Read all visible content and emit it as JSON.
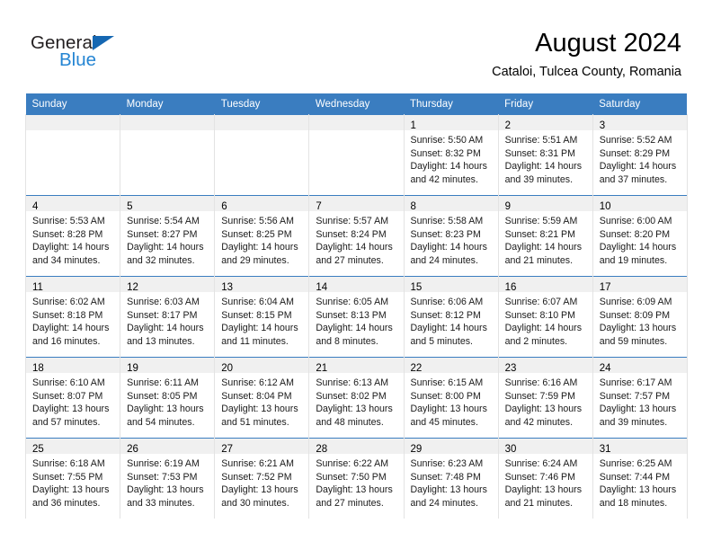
{
  "brand": {
    "name_dark": "General",
    "name_light": "Blue",
    "triangle_color": "#1567b2",
    "blue_color": "#2585d3"
  },
  "header": {
    "title": "August 2024",
    "subtitle": "Cataloi, Tulcea County, Romania"
  },
  "theme": {
    "header_row_bg": "#3a7dc0",
    "header_row_text": "#ffffff",
    "daynum_band_bg": "#f0f0f0",
    "cell_border": "#e3e3e3",
    "week_divider": "#3a7dc0"
  },
  "weekday_headers": [
    "Sunday",
    "Monday",
    "Tuesday",
    "Wednesday",
    "Thursday",
    "Friday",
    "Saturday"
  ],
  "weeks": [
    [
      {
        "day": "",
        "empty": true,
        "sunrise": "",
        "sunset": "",
        "daylight_1": "",
        "daylight_2": ""
      },
      {
        "day": "",
        "empty": true,
        "sunrise": "",
        "sunset": "",
        "daylight_1": "",
        "daylight_2": ""
      },
      {
        "day": "",
        "empty": true,
        "sunrise": "",
        "sunset": "",
        "daylight_1": "",
        "daylight_2": ""
      },
      {
        "day": "",
        "empty": true,
        "sunrise": "",
        "sunset": "",
        "daylight_1": "",
        "daylight_2": ""
      },
      {
        "day": "1",
        "empty": false,
        "sunrise": "Sunrise: 5:50 AM",
        "sunset": "Sunset: 8:32 PM",
        "daylight_1": "Daylight: 14 hours",
        "daylight_2": "and 42 minutes."
      },
      {
        "day": "2",
        "empty": false,
        "sunrise": "Sunrise: 5:51 AM",
        "sunset": "Sunset: 8:31 PM",
        "daylight_1": "Daylight: 14 hours",
        "daylight_2": "and 39 minutes."
      },
      {
        "day": "3",
        "empty": false,
        "sunrise": "Sunrise: 5:52 AM",
        "sunset": "Sunset: 8:29 PM",
        "daylight_1": "Daylight: 14 hours",
        "daylight_2": "and 37 minutes."
      }
    ],
    [
      {
        "day": "4",
        "empty": false,
        "sunrise": "Sunrise: 5:53 AM",
        "sunset": "Sunset: 8:28 PM",
        "daylight_1": "Daylight: 14 hours",
        "daylight_2": "and 34 minutes."
      },
      {
        "day": "5",
        "empty": false,
        "sunrise": "Sunrise: 5:54 AM",
        "sunset": "Sunset: 8:27 PM",
        "daylight_1": "Daylight: 14 hours",
        "daylight_2": "and 32 minutes."
      },
      {
        "day": "6",
        "empty": false,
        "sunrise": "Sunrise: 5:56 AM",
        "sunset": "Sunset: 8:25 PM",
        "daylight_1": "Daylight: 14 hours",
        "daylight_2": "and 29 minutes."
      },
      {
        "day": "7",
        "empty": false,
        "sunrise": "Sunrise: 5:57 AM",
        "sunset": "Sunset: 8:24 PM",
        "daylight_1": "Daylight: 14 hours",
        "daylight_2": "and 27 minutes."
      },
      {
        "day": "8",
        "empty": false,
        "sunrise": "Sunrise: 5:58 AM",
        "sunset": "Sunset: 8:23 PM",
        "daylight_1": "Daylight: 14 hours",
        "daylight_2": "and 24 minutes."
      },
      {
        "day": "9",
        "empty": false,
        "sunrise": "Sunrise: 5:59 AM",
        "sunset": "Sunset: 8:21 PM",
        "daylight_1": "Daylight: 14 hours",
        "daylight_2": "and 21 minutes."
      },
      {
        "day": "10",
        "empty": false,
        "sunrise": "Sunrise: 6:00 AM",
        "sunset": "Sunset: 8:20 PM",
        "daylight_1": "Daylight: 14 hours",
        "daylight_2": "and 19 minutes."
      }
    ],
    [
      {
        "day": "11",
        "empty": false,
        "sunrise": "Sunrise: 6:02 AM",
        "sunset": "Sunset: 8:18 PM",
        "daylight_1": "Daylight: 14 hours",
        "daylight_2": "and 16 minutes."
      },
      {
        "day": "12",
        "empty": false,
        "sunrise": "Sunrise: 6:03 AM",
        "sunset": "Sunset: 8:17 PM",
        "daylight_1": "Daylight: 14 hours",
        "daylight_2": "and 13 minutes."
      },
      {
        "day": "13",
        "empty": false,
        "sunrise": "Sunrise: 6:04 AM",
        "sunset": "Sunset: 8:15 PM",
        "daylight_1": "Daylight: 14 hours",
        "daylight_2": "and 11 minutes."
      },
      {
        "day": "14",
        "empty": false,
        "sunrise": "Sunrise: 6:05 AM",
        "sunset": "Sunset: 8:13 PM",
        "daylight_1": "Daylight: 14 hours",
        "daylight_2": "and 8 minutes."
      },
      {
        "day": "15",
        "empty": false,
        "sunrise": "Sunrise: 6:06 AM",
        "sunset": "Sunset: 8:12 PM",
        "daylight_1": "Daylight: 14 hours",
        "daylight_2": "and 5 minutes."
      },
      {
        "day": "16",
        "empty": false,
        "sunrise": "Sunrise: 6:07 AM",
        "sunset": "Sunset: 8:10 PM",
        "daylight_1": "Daylight: 14 hours",
        "daylight_2": "and 2 minutes."
      },
      {
        "day": "17",
        "empty": false,
        "sunrise": "Sunrise: 6:09 AM",
        "sunset": "Sunset: 8:09 PM",
        "daylight_1": "Daylight: 13 hours",
        "daylight_2": "and 59 minutes."
      }
    ],
    [
      {
        "day": "18",
        "empty": false,
        "sunrise": "Sunrise: 6:10 AM",
        "sunset": "Sunset: 8:07 PM",
        "daylight_1": "Daylight: 13 hours",
        "daylight_2": "and 57 minutes."
      },
      {
        "day": "19",
        "empty": false,
        "sunrise": "Sunrise: 6:11 AM",
        "sunset": "Sunset: 8:05 PM",
        "daylight_1": "Daylight: 13 hours",
        "daylight_2": "and 54 minutes."
      },
      {
        "day": "20",
        "empty": false,
        "sunrise": "Sunrise: 6:12 AM",
        "sunset": "Sunset: 8:04 PM",
        "daylight_1": "Daylight: 13 hours",
        "daylight_2": "and 51 minutes."
      },
      {
        "day": "21",
        "empty": false,
        "sunrise": "Sunrise: 6:13 AM",
        "sunset": "Sunset: 8:02 PM",
        "daylight_1": "Daylight: 13 hours",
        "daylight_2": "and 48 minutes."
      },
      {
        "day": "22",
        "empty": false,
        "sunrise": "Sunrise: 6:15 AM",
        "sunset": "Sunset: 8:00 PM",
        "daylight_1": "Daylight: 13 hours",
        "daylight_2": "and 45 minutes."
      },
      {
        "day": "23",
        "empty": false,
        "sunrise": "Sunrise: 6:16 AM",
        "sunset": "Sunset: 7:59 PM",
        "daylight_1": "Daylight: 13 hours",
        "daylight_2": "and 42 minutes."
      },
      {
        "day": "24",
        "empty": false,
        "sunrise": "Sunrise: 6:17 AM",
        "sunset": "Sunset: 7:57 PM",
        "daylight_1": "Daylight: 13 hours",
        "daylight_2": "and 39 minutes."
      }
    ],
    [
      {
        "day": "25",
        "empty": false,
        "sunrise": "Sunrise: 6:18 AM",
        "sunset": "Sunset: 7:55 PM",
        "daylight_1": "Daylight: 13 hours",
        "daylight_2": "and 36 minutes."
      },
      {
        "day": "26",
        "empty": false,
        "sunrise": "Sunrise: 6:19 AM",
        "sunset": "Sunset: 7:53 PM",
        "daylight_1": "Daylight: 13 hours",
        "daylight_2": "and 33 minutes."
      },
      {
        "day": "27",
        "empty": false,
        "sunrise": "Sunrise: 6:21 AM",
        "sunset": "Sunset: 7:52 PM",
        "daylight_1": "Daylight: 13 hours",
        "daylight_2": "and 30 minutes."
      },
      {
        "day": "28",
        "empty": false,
        "sunrise": "Sunrise: 6:22 AM",
        "sunset": "Sunset: 7:50 PM",
        "daylight_1": "Daylight: 13 hours",
        "daylight_2": "and 27 minutes."
      },
      {
        "day": "29",
        "empty": false,
        "sunrise": "Sunrise: 6:23 AM",
        "sunset": "Sunset: 7:48 PM",
        "daylight_1": "Daylight: 13 hours",
        "daylight_2": "and 24 minutes."
      },
      {
        "day": "30",
        "empty": false,
        "sunrise": "Sunrise: 6:24 AM",
        "sunset": "Sunset: 7:46 PM",
        "daylight_1": "Daylight: 13 hours",
        "daylight_2": "and 21 minutes."
      },
      {
        "day": "31",
        "empty": false,
        "sunrise": "Sunrise: 6:25 AM",
        "sunset": "Sunset: 7:44 PM",
        "daylight_1": "Daylight: 13 hours",
        "daylight_2": "and 18 minutes."
      }
    ]
  ]
}
